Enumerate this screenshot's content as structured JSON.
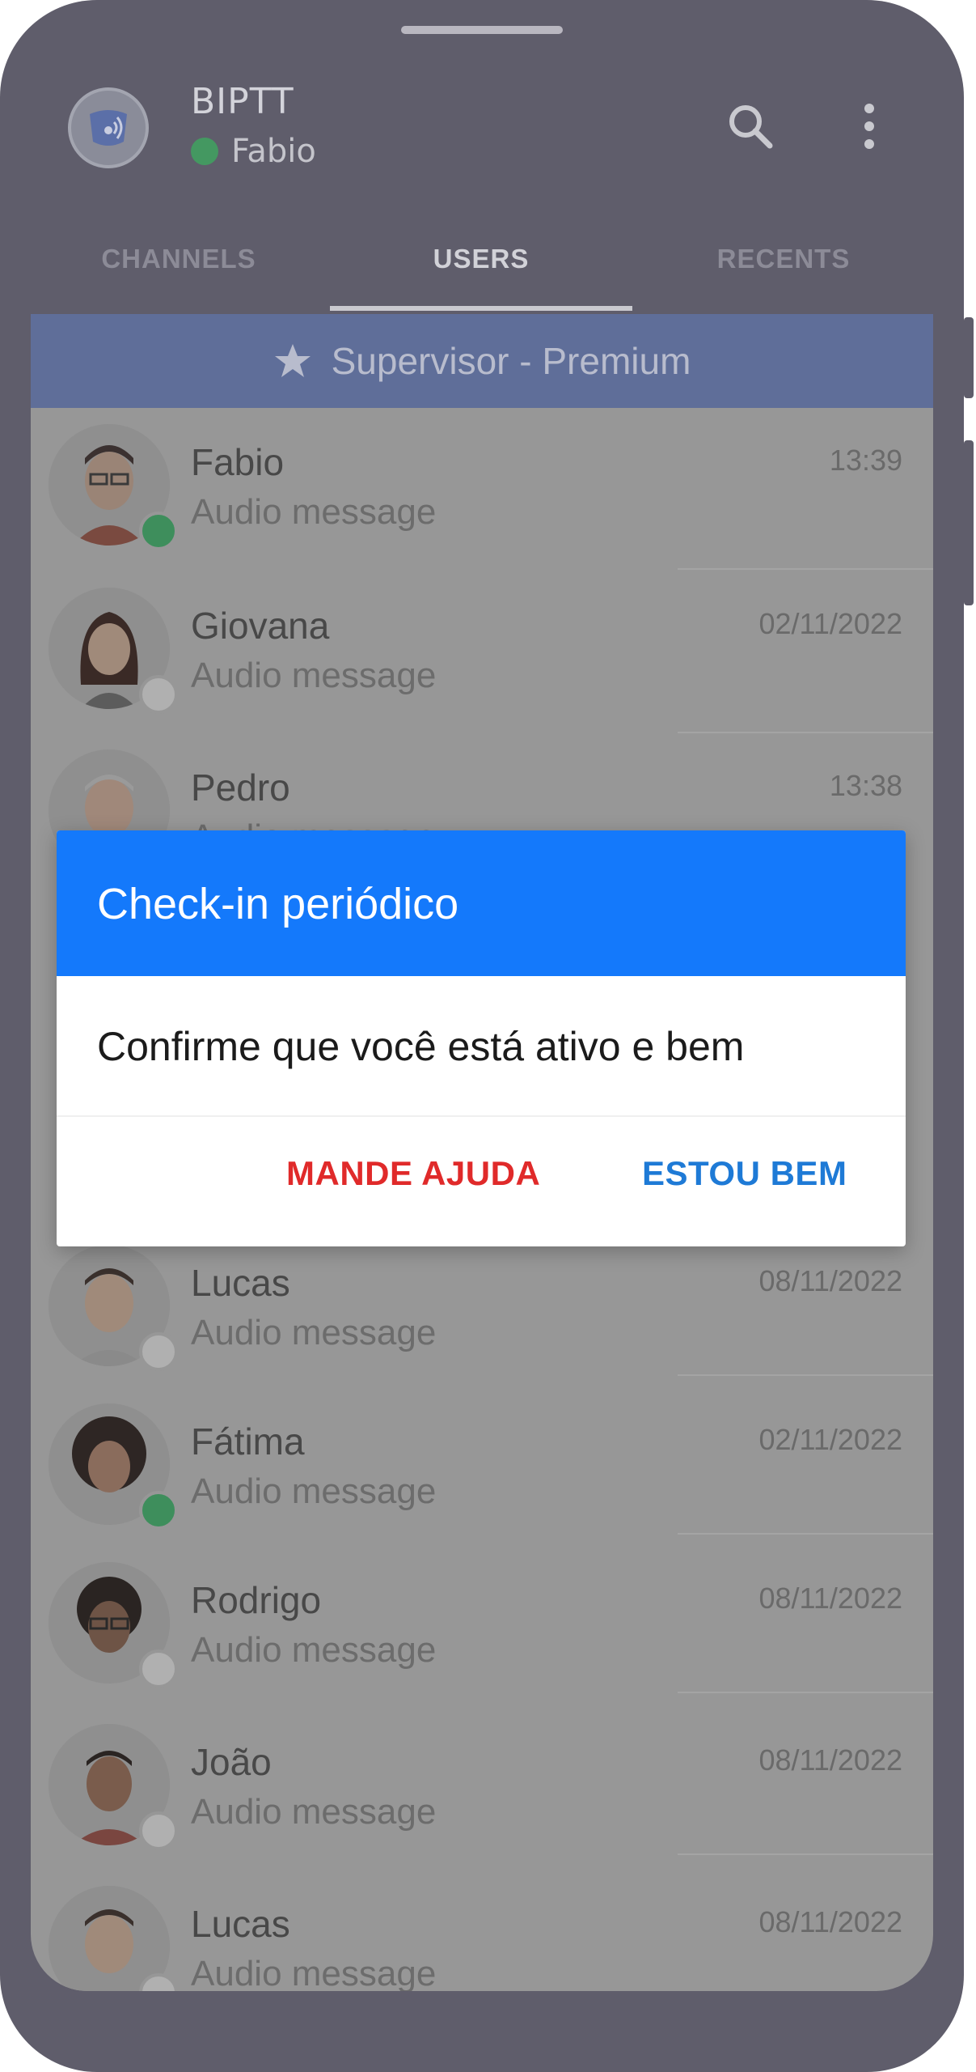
{
  "app": {
    "title": "BIPTT",
    "current_user": "Fabio"
  },
  "header_icons": {
    "search": "search-icon",
    "more": "more-vertical-icon"
  },
  "tabs": [
    {
      "label": "CHANNELS",
      "active": false
    },
    {
      "label": "USERS",
      "active": true
    },
    {
      "label": "RECENTS",
      "active": false
    }
  ],
  "group_bar": {
    "label": "Supervisor  -  Premium",
    "icon": "star-icon"
  },
  "users": [
    {
      "name": "Fabio",
      "subtitle": "Audio message",
      "time": "13:39",
      "status": "online"
    },
    {
      "name": "Giovana",
      "subtitle": "Audio message",
      "time": "02/11/2022",
      "status": "offline"
    },
    {
      "name": "Pedro",
      "subtitle": "Audio message",
      "time": "13:38",
      "status": "offline"
    },
    {
      "name": "Lucas",
      "subtitle": "Audio message",
      "time": "08/11/2022",
      "status": "offline"
    },
    {
      "name": "Fátima",
      "subtitle": "Audio message",
      "time": "02/11/2022",
      "status": "online"
    },
    {
      "name": "Rodrigo",
      "subtitle": "Audio message",
      "time": "08/11/2022",
      "status": "offline"
    },
    {
      "name": "João",
      "subtitle": "Audio message",
      "time": "08/11/2022",
      "status": "offline"
    },
    {
      "name": "Lucas",
      "subtitle": "Audio message",
      "time": "08/11/2022",
      "status": "offline"
    }
  ],
  "dialog": {
    "title": "Check-in periódico",
    "message": "Confirme que você está ativo e bem",
    "help_button": "MANDE AJUDA",
    "ok_button": "ESTOU BEM"
  },
  "colors": {
    "dialog_header": "#1479fb",
    "help_button": "#e02a2a",
    "ok_button": "#1e7ad6",
    "online": "#3e8e5c",
    "offline": "#b0b0b0"
  }
}
